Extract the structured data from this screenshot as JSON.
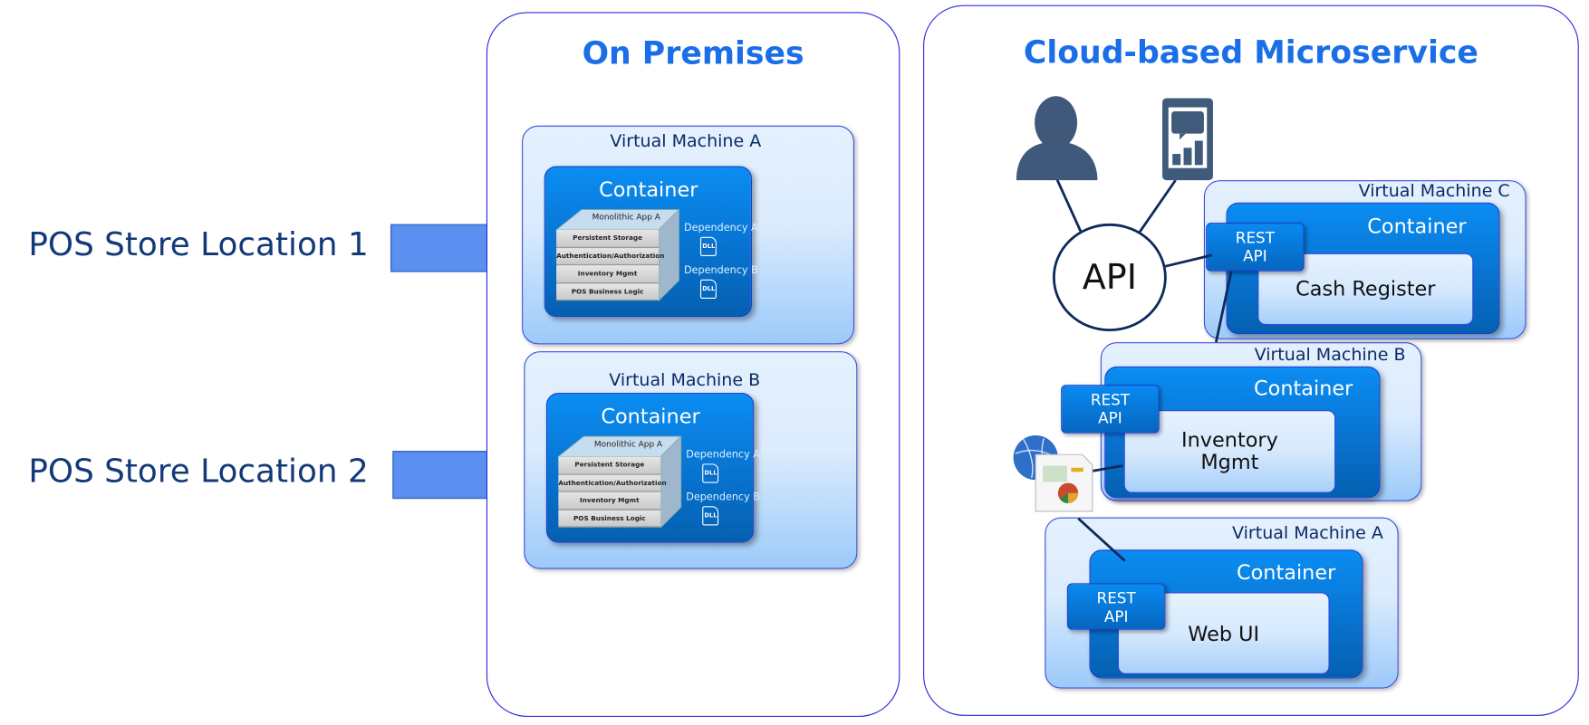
{
  "left_labels": [
    "POS Store Location 1",
    "POS Store Location 2"
  ],
  "on_premises": {
    "title": "On Premises",
    "vms": [
      {
        "title": "Virtual Machine A",
        "container": "Container",
        "app": "Monolithic App A",
        "layers": [
          "Persistent Storage",
          "Authentication/Authorization",
          "Inventory Mgmt",
          "POS Business Logic"
        ],
        "dependencies": [
          "Dependency A",
          "Dependency B"
        ],
        "dll": "DLL"
      },
      {
        "title": "Virtual Machine  B",
        "container": "Container",
        "app": "Monolithic App A",
        "layers": [
          "Persistent Storage",
          "Authentication/Authorization",
          "Inventory Mgmt",
          "POS Business Logic"
        ],
        "dependencies": [
          "Dependency A",
          "Dependency B"
        ],
        "dll": "DLL"
      }
    ]
  },
  "cloud": {
    "title": "Cloud-based Microservice",
    "api_label": "API",
    "icons": [
      "user-icon",
      "mobile-phone-icon",
      "globe-report-icon"
    ],
    "vm_c": {
      "title": "Virtual Machine C",
      "container": "Container",
      "rest": [
        "REST",
        "API"
      ],
      "service": "Cash Register"
    },
    "vm_b": {
      "title": "Virtual Machine B",
      "container": "Container",
      "rest": [
        "REST",
        "API"
      ],
      "service_lines": [
        "Inventory",
        "Mgmt"
      ]
    },
    "vm_a": {
      "title": "Virtual Machine A",
      "container": "Container",
      "rest": [
        "REST",
        "API"
      ],
      "service": "Web UI"
    }
  },
  "colors": {
    "title_blue": "#1a6fe8",
    "arrow": "#5b8ff0",
    "container": "#0873d0",
    "icon": "#3f5a7a"
  }
}
